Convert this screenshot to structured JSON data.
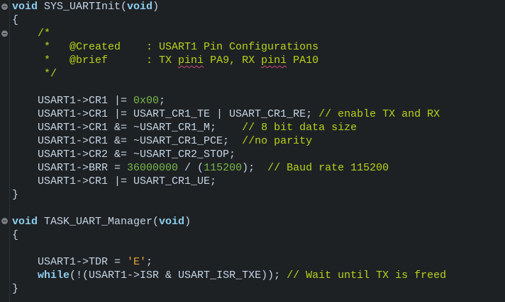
{
  "code": {
    "l1": {
      "kw1": "void",
      "name": " SYS_UARTInit(",
      "kw2": "void",
      "end": ")"
    },
    "l2": "{",
    "l3": "    /*",
    "l4": "     *   @Created    : USART1 Pin Configurations",
    "l5": {
      "a": "     *   @brief      : TX ",
      "w1": "pini",
      "b": " PA9, RX ",
      "w2": "pini",
      "c": " PA10"
    },
    "l6": "     */",
    "l8": {
      "a": "    USART1->CR1 |= ",
      "num": "0x00",
      "b": ";"
    },
    "l9": {
      "a": "    USART1->CR1 |= USART_CR1_TE | USART_CR1_RE; ",
      "cm": "// enable TX and RX"
    },
    "l10": {
      "a": "    USART1->CR1 &= ~USART_CR1_M;    ",
      "cm": "// 8 bit data size"
    },
    "l11": {
      "a": "    USART1->CR1 &= ~USART_CR1_PCE;  ",
      "cm": "//no parity"
    },
    "l12": "    USART1->CR2 &= ~USART_CR2_STOP;",
    "l13": {
      "a": "    USART1->BRR = ",
      "n1": "36000000",
      "b": " / (",
      "n2": "115200",
      "c": ");  ",
      "cm": "// Baud rate 115200"
    },
    "l14": "    USART1->CR1 |= USART_CR1_UE;",
    "l15": "}",
    "l17": {
      "kw1": "void",
      "name": " TASK_UART_Manager(",
      "kw2": "void",
      "end": ")"
    },
    "l18": "{",
    "l20": {
      "a": "    USART1->TDR = ",
      "str": "'E'",
      "b": ";"
    },
    "l21": {
      "indent": "    ",
      "kw": "while",
      "a": "(!(USART1->ISR & USART_ISR_TXE)); ",
      "cm": "// Wait until TX is freed"
    },
    "l22": "}"
  },
  "colors": {
    "background": "#1e2124",
    "keyword": "#8ccfee",
    "comment": "#b8d21a",
    "number": "#78b84a",
    "string": "#e6a43a",
    "text": "#c5d5e4"
  }
}
